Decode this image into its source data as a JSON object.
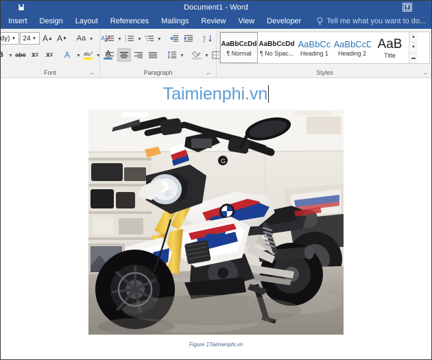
{
  "window": {
    "title": "Document1 - Word",
    "qat_icon": "save-icon",
    "ribbon_display_icon": "ribbon-display-options-icon"
  },
  "tabs": [
    {
      "label": "Insert",
      "active": false
    },
    {
      "label": "Design",
      "active": false
    },
    {
      "label": "Layout",
      "active": false
    },
    {
      "label": "References",
      "active": false
    },
    {
      "label": "Mailings",
      "active": false
    },
    {
      "label": "Review",
      "active": false
    },
    {
      "label": "View",
      "active": false
    },
    {
      "label": "Developer",
      "active": false
    }
  ],
  "tell_me": {
    "placeholder": "Tell me what you want to do...",
    "icon": "lightbulb-icon"
  },
  "ribbon": {
    "font_group": {
      "label": "Font",
      "font_name": "ody)",
      "font_size": "24",
      "grow_font": "A",
      "shrink_font": "A",
      "change_case": "Aa",
      "clear_formatting_icon": "clear-formatting-icon",
      "bold": "B",
      "strikethrough": "abc",
      "subscript": "x",
      "subscript_sub": "2",
      "superscript": "x",
      "superscript_sup": "2",
      "text_effects": "A",
      "highlight": "ab",
      "font_color": "A",
      "dialog_launcher": "font-dialog-launcher"
    },
    "paragraph_group": {
      "label": "Paragraph",
      "bullets_icon": "bullet-list-icon",
      "numbering_icon": "numbered-list-icon",
      "multilevel_icon": "multilevel-list-icon",
      "decrease_indent_icon": "decrease-indent-icon",
      "increase_indent_icon": "increase-indent-icon",
      "sort_icon": "sort-icon",
      "show_marks_icon": "pilcrow-icon",
      "align_left_icon": "align-left-icon",
      "align_center_icon": "align-center-icon",
      "align_right_icon": "align-right-icon",
      "justify_icon": "justify-icon",
      "line_spacing_icon": "line-spacing-icon",
      "shading_icon": "shading-icon",
      "borders_icon": "borders-icon",
      "active_alignment": "align-center",
      "dialog_launcher": "paragraph-dialog-launcher"
    },
    "styles_group": {
      "label": "Styles",
      "dialog_launcher": "styles-dialog-launcher",
      "items": [
        {
          "preview": "AaBbCcDd",
          "name": "¶ Normal",
          "style": "plain",
          "selected": true
        },
        {
          "preview": "AaBbCcDd",
          "name": "¶ No Spac...",
          "style": "plain",
          "selected": false
        },
        {
          "preview": "AaBbCc",
          "name": "Heading 1",
          "style": "blue",
          "selected": false
        },
        {
          "preview": "AaBbCcD",
          "name": "Heading 2",
          "style": "blue",
          "selected": false
        },
        {
          "preview": "AaB",
          "name": "Title",
          "style": "title",
          "selected": false
        }
      ],
      "scroll_up": "▲",
      "scroll_down": "▼",
      "more": "▬"
    }
  },
  "document": {
    "heading_text": "Taimienphi.vn",
    "heading_color": "#5b9bd5",
    "caption_text": "Figure 1Taimienphi.vn",
    "caption_color": "#4a5f8e",
    "image_alt": "BMW G310R motorcycle white red blue in showroom"
  }
}
